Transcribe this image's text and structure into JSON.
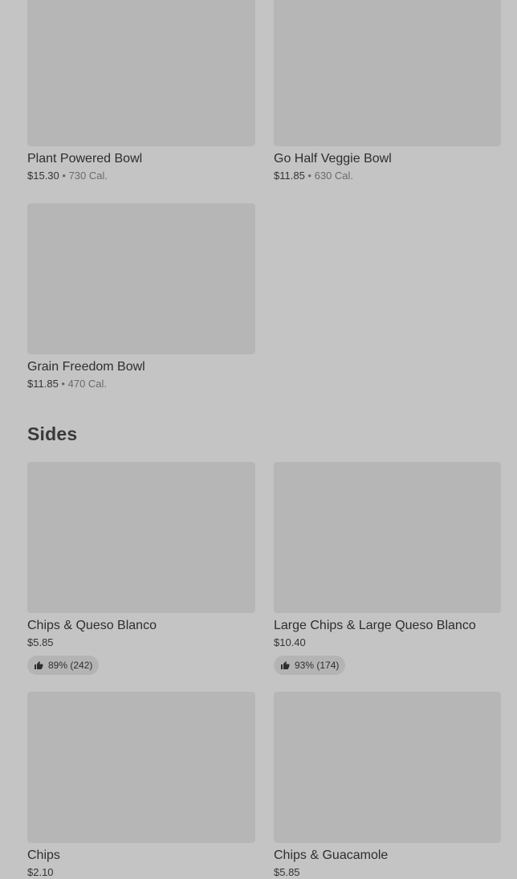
{
  "bowls": [
    {
      "name": "Plant Powered Bowl",
      "price": "$15.30",
      "separator": "•",
      "calories": "730 Cal."
    },
    {
      "name": "Go Half Veggie Bowl",
      "price": "$11.85",
      "separator": "•",
      "calories": "630 Cal."
    },
    {
      "name": "Grain Freedom Bowl",
      "price": "$11.85",
      "separator": "•",
      "calories": "470 Cal."
    }
  ],
  "sides": {
    "title": "Sides",
    "items": [
      {
        "name": "Chips & Queso Blanco",
        "price": "$5.85",
        "rating": "89% (242)"
      },
      {
        "name": "Large Chips & Large Queso Blanco",
        "price": "$10.40",
        "rating": "93% (174)"
      },
      {
        "name": "Chips",
        "price": "$2.10"
      },
      {
        "name": "Chips & Guacamole",
        "price": "$5.85"
      }
    ]
  },
  "icons": {
    "rating": "thumbs-up-icon"
  }
}
